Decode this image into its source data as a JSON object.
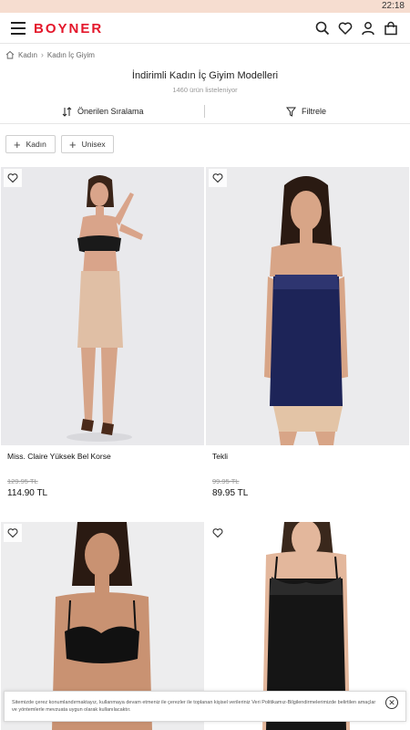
{
  "status_bar": {
    "time": "22:18"
  },
  "header": {
    "logo": "BOYNER",
    "icons": [
      "search-icon",
      "heart-icon",
      "user-icon",
      "bag-icon"
    ],
    "brand_color": "#e4172b"
  },
  "breadcrumb": {
    "items": [
      "Kadın",
      "Kadın İç Giyim"
    ]
  },
  "listing": {
    "title": "İndirimli Kadın İç Giyim Modelleri",
    "count": "1460 ürün listeleniyor"
  },
  "toolbar": {
    "sort_label": "Önerilen Sıralama",
    "filter_label": "Filtrele"
  },
  "chips": [
    {
      "label": "Kadın"
    },
    {
      "label": "Unisex"
    }
  ],
  "products": [
    {
      "name": "Miss. Claire Yüksek Bel Korse",
      "old_price": "129.95 TL",
      "price": "114.90 TL"
    },
    {
      "name": "Tekli",
      "old_price": "99.95 TL",
      "price": "89.95 TL"
    },
    {
      "name": "",
      "old_price": "",
      "price": ""
    },
    {
      "name": "",
      "old_price": "",
      "price": ""
    }
  ],
  "cookie": {
    "text": "Sitemizde çerez konumlandırmaktayız, kullanmaya devam etmeniz ile çerezler ile toplanan kişisel verileriniz Veri Politikamız-Bilgilendirmelerimizde belirtilen amaçlar ve yöntemlerle mevzuata uygun olarak kullanılacaktır."
  }
}
